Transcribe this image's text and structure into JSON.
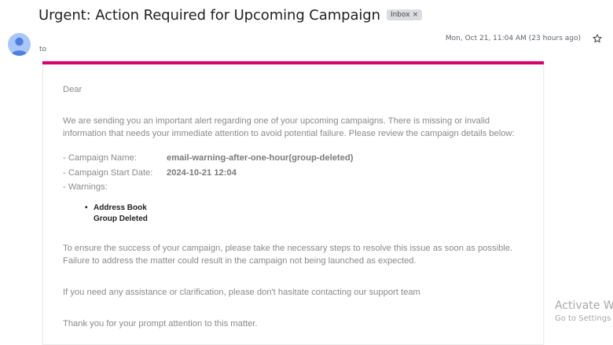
{
  "email": {
    "subject": "Urgent: Action Required for Upcoming Campaign",
    "label_chip": "Inbox",
    "label_remove": "×",
    "to_label": "to",
    "date": "Mon, Oct 21, 11:04 AM (23 hours ago)",
    "accent_color": "#d6006f"
  },
  "body": {
    "greeting": "Dear",
    "intro": "We are sending you an important alert regarding one of your upcoming campaigns. There is missing or invalid information that needs your immediate attention to avoid potential failure. Please review the campaign details below:",
    "details": [
      {
        "label": "- Campaign Name:",
        "value": "email-warning-after-one-hour(group-deleted)"
      },
      {
        "label": "- Campaign Start Date:",
        "value": "2024-10-21 12:04"
      },
      {
        "label": "- Warnings:",
        "value": ""
      }
    ],
    "warnings": [
      "Address Book",
      "Group Deleted"
    ],
    "ensure": "To ensure the success of your campaign, please take the necessary steps to resolve this issue as soon as possible. Failure to address the matter could result in the campaign not being launched as expected.",
    "assist": "If you need any assistance or clarification, please don't hasitate contacting our support team",
    "thanks": "Thank you for your prompt attention to this matter."
  },
  "watermark": {
    "line1": "Activate Wi",
    "line2": "Go to Settings to"
  },
  "icons": {
    "avatar": "person-avatar-icon",
    "star": "star-icon",
    "chip_close": "close-icon"
  }
}
